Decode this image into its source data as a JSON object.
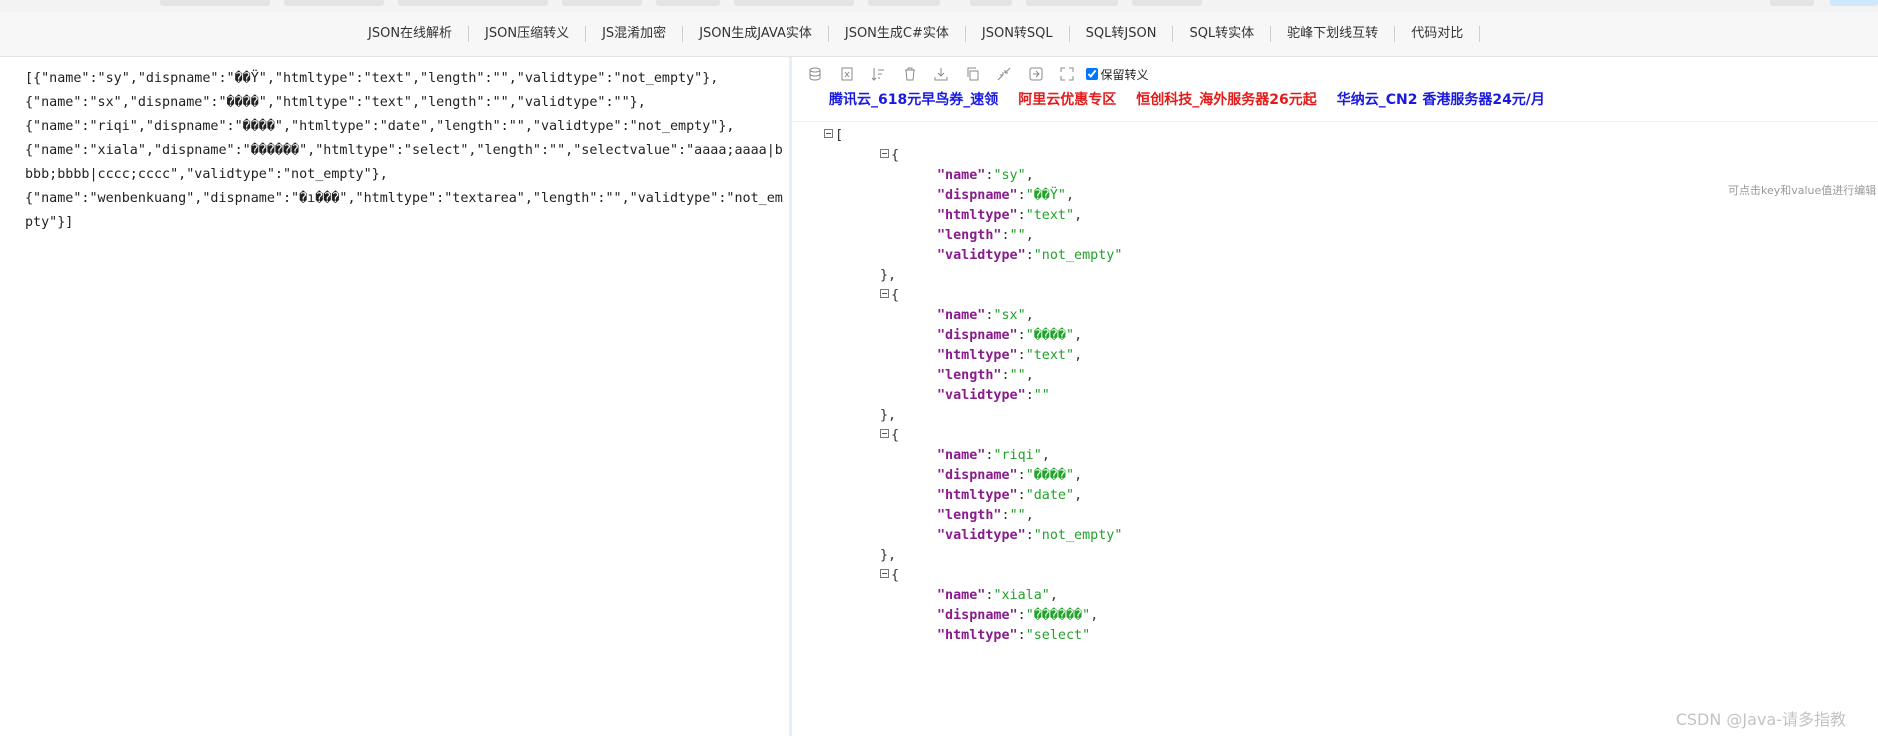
{
  "nav": {
    "items": [
      "JSON在线解析",
      "JSON压缩转义",
      "JS混淆加密",
      "JSON生成JAVA实体",
      "JSON生成C#实体",
      "JSON转SQL",
      "SQL转JSON",
      "SQL转实体",
      "驼峰下划线互转",
      "代码对比"
    ]
  },
  "input": {
    "text": "[{\"name\":\"sy\",\"dispname\":\"��Ÿ\",\"htmltype\":\"text\",\"length\":\"\",\"validtype\":\"not_empty\"},\n{\"name\":\"sx\",\"dispname\":\"����\",\"htmltype\":\"text\",\"length\":\"\",\"validtype\":\"\"},\n{\"name\":\"riqi\",\"dispname\":\"����\",\"htmltype\":\"date\",\"length\":\"\",\"validtype\":\"not_empty\"},\n{\"name\":\"xiala\",\"dispname\":\"������\",\"htmltype\":\"select\",\"length\":\"\",\"selectvalue\":\"aaaa;aaaa|bbbb;bbbb|cccc;cccc\",\"validtype\":\"not_empty\"},\n{\"name\":\"wenbenkuang\",\"dispname\":\"�ı���\",\"htmltype\":\"textarea\",\"length\":\"\",\"validtype\":\"not_empty\"}]"
  },
  "toolbar": {
    "icons": [
      "database-icon",
      "excel-icon",
      "sort-icon",
      "trash-icon",
      "download-icon",
      "copy-icon",
      "compress-icon",
      "share-icon",
      "fullscreen-icon"
    ],
    "escape_label": "保留转义",
    "escape_checked": true
  },
  "ads": [
    {
      "text": "腾讯云_618元早鸟券_速领",
      "color": "#1a1adf"
    },
    {
      "text": "阿里云优惠专区",
      "color": "#e41b1b"
    },
    {
      "text": "恒创科技_海外服务器26元起",
      "color": "#e41b1b"
    },
    {
      "text": "华纳云_CN2 香港服务器24元/月",
      "color": "#1a1adf"
    }
  ],
  "hint": "可点击key和value值进行编辑",
  "tree": {
    "objects": [
      [
        [
          "name",
          "sy"
        ],
        [
          "dispname",
          "��Ÿ"
        ],
        [
          "htmltype",
          "text"
        ],
        [
          "length",
          ""
        ],
        [
          "validtype",
          "not_empty"
        ]
      ],
      [
        [
          "name",
          "sx"
        ],
        [
          "dispname",
          "����"
        ],
        [
          "htmltype",
          "text"
        ],
        [
          "length",
          ""
        ],
        [
          "validtype",
          ""
        ]
      ],
      [
        [
          "name",
          "riqi"
        ],
        [
          "dispname",
          "����"
        ],
        [
          "htmltype",
          "date"
        ],
        [
          "length",
          ""
        ],
        [
          "validtype",
          "not_empty"
        ]
      ],
      [
        [
          "name",
          "xiala"
        ],
        [
          "dispname",
          "������"
        ],
        [
          "htmltype",
          "select"
        ]
      ]
    ]
  },
  "watermark": "CSDN @Java-请多指教"
}
